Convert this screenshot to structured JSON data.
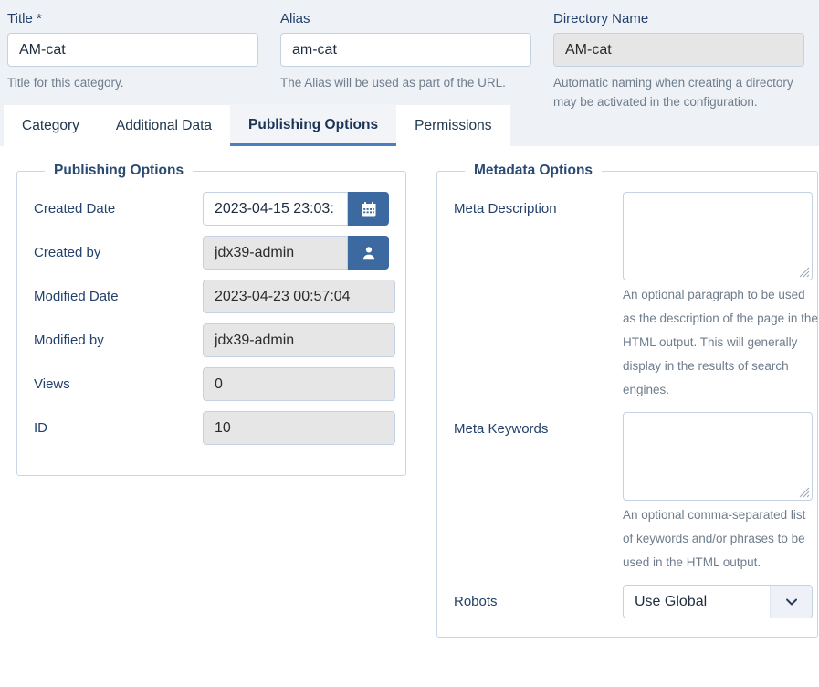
{
  "header": {
    "fields": [
      {
        "label": "Title *",
        "value": "AM-cat",
        "help": "Title for this category.",
        "readonly": false,
        "name": "title"
      },
      {
        "label": "Alias",
        "value": "am-cat",
        "help": "The Alias will be used as part of the URL.",
        "readonly": false,
        "name": "alias"
      },
      {
        "label": "Directory Name",
        "value": "AM-cat",
        "help": "Automatic naming when creating a directory may be activated in the configuration.",
        "readonly": true,
        "name": "directory-name"
      }
    ]
  },
  "tabs": [
    {
      "label": "Category",
      "active": false
    },
    {
      "label": "Additional Data",
      "active": false
    },
    {
      "label": "Publishing Options",
      "active": true
    },
    {
      "label": "Permissions",
      "active": false
    }
  ],
  "publishing": {
    "legend": "Publishing Options",
    "rows": [
      {
        "label": "Created Date",
        "value": "2023-04-15 23:03:",
        "kind": "input-button",
        "icon": "calendar-icon",
        "readonly": false,
        "name": "created-date"
      },
      {
        "label": "Created by",
        "value": "jdx39-admin",
        "kind": "input-button",
        "icon": "user-icon",
        "readonly": true,
        "name": "created-by"
      },
      {
        "label": "Modified Date",
        "value": "2023-04-23 00:57:04",
        "kind": "input",
        "readonly": true,
        "name": "modified-date"
      },
      {
        "label": "Modified by",
        "value": "jdx39-admin",
        "kind": "input",
        "readonly": true,
        "name": "modified-by"
      },
      {
        "label": "Views",
        "value": "0",
        "kind": "input",
        "readonly": true,
        "name": "views"
      },
      {
        "label": "ID",
        "value": "10",
        "kind": "input",
        "readonly": true,
        "name": "id"
      }
    ]
  },
  "metadata": {
    "legend": "Metadata Options",
    "meta_description": {
      "label": "Meta Description",
      "value": "",
      "help": "An optional paragraph to be used as the description of the page in the HTML output. This will generally display in the results of search engines."
    },
    "meta_keywords": {
      "label": "Meta Keywords",
      "value": "",
      "help": "An optional comma-separated list of keywords and/or phrases to be used in the HTML output."
    },
    "robots": {
      "label": "Robots",
      "value": "Use Global"
    }
  },
  "colors": {
    "accent": "#3c6aa0",
    "header_bg": "#eef1f6",
    "label": "#23416b",
    "help": "#6f7d8c",
    "border": "#c3d1e2",
    "tab_active_underline": "#4c7fbf"
  }
}
